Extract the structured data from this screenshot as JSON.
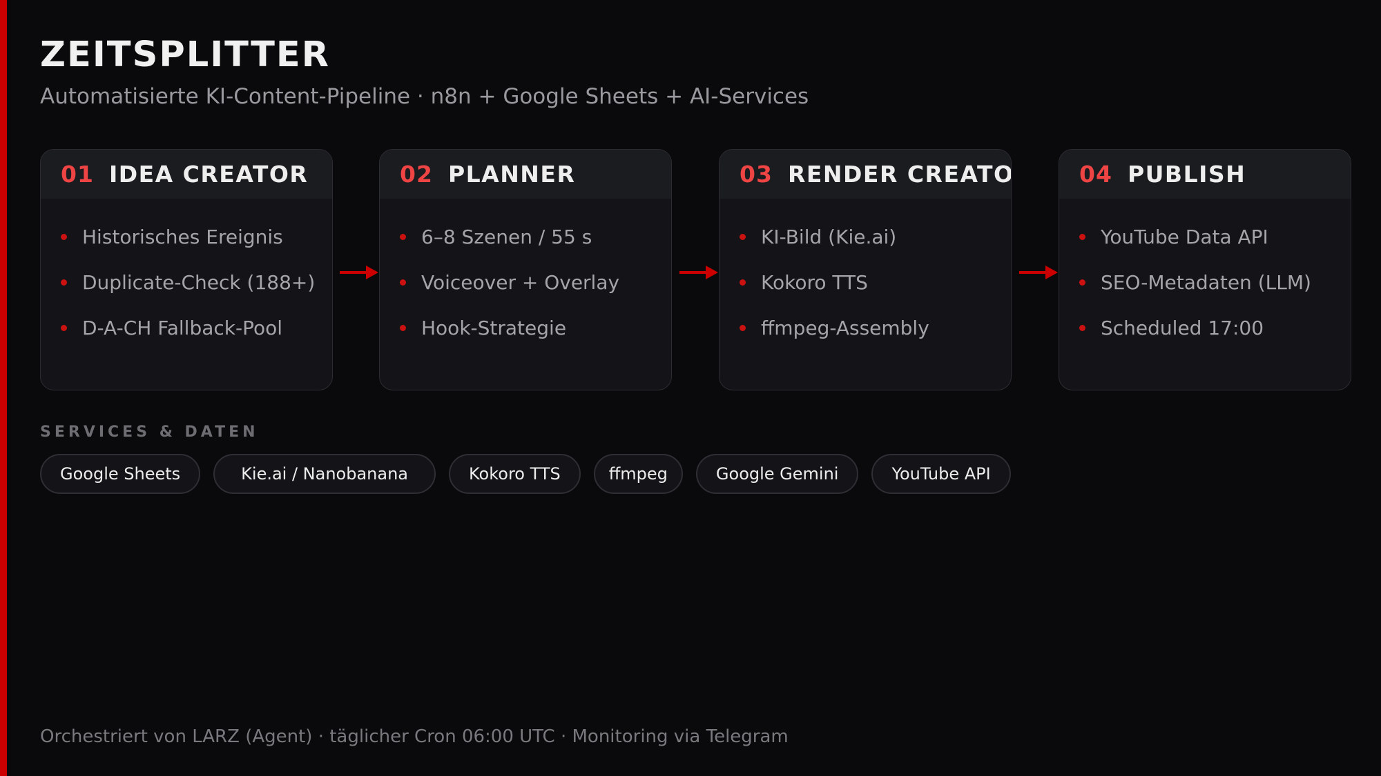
{
  "header": {
    "title": "ZEITSPLITTER",
    "subtitle": "Automatisierte KI-Content-Pipeline · n8n + Google Sheets + AI-Services"
  },
  "pipeline": {
    "stages": [
      {
        "number": "01",
        "title": "IDEA CREATOR",
        "items": [
          "Historisches Ereignis",
          "Duplicate-Check (188+)",
          "D-A-CH Fallback-Pool"
        ]
      },
      {
        "number": "02",
        "title": "PLANNER",
        "items": [
          "6–8 Szenen / 55 s",
          "Voiceover + Overlay",
          "Hook-Strategie"
        ]
      },
      {
        "number": "03",
        "title": "RENDER CREATOR",
        "items": [
          "KI-Bild (Kie.ai)",
          "Kokoro TTS",
          "ffmpeg-Assembly"
        ]
      },
      {
        "number": "04",
        "title": "PUBLISH",
        "items": [
          "YouTube Data API",
          "SEO-Metadaten (LLM)",
          "Scheduled 17:00"
        ]
      }
    ]
  },
  "services": {
    "label": "SERVICES & DATEN",
    "chips": [
      "Google Sheets",
      "Kie.ai / Nanobanana",
      "Kokoro TTS",
      "ffmpeg",
      "Google Gemini",
      "YouTube API"
    ]
  },
  "footer": {
    "text": "Orchestriert von LARZ (Agent) · täglicher Cron 06:00 UTC · Monitoring via Telegram"
  },
  "colors": {
    "background": "#0a0a0c",
    "accent": "#cc0000",
    "stage_number": "#ee4444",
    "card_background": "#141418"
  }
}
